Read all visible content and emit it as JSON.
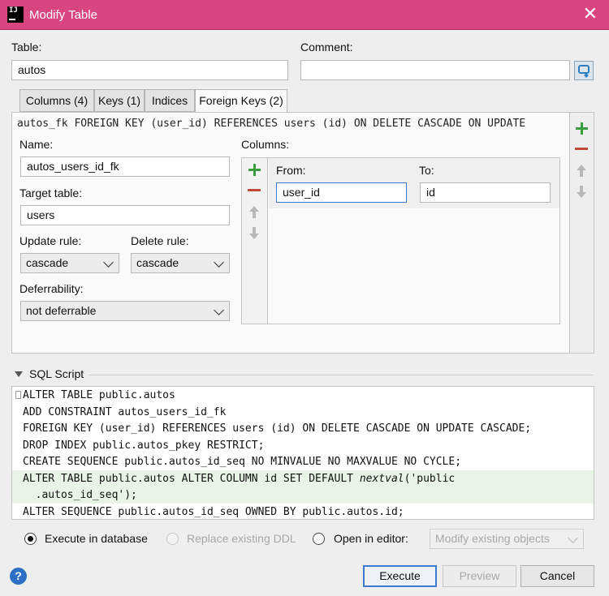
{
  "window": {
    "title": "Modify Table",
    "app_icon": "intellij-logo",
    "app_icon_text": "IJ"
  },
  "table": {
    "label": "Table:",
    "value": "autos"
  },
  "comment": {
    "label": "Comment:",
    "value": ""
  },
  "tabs": [
    {
      "label": "Columns (4)",
      "active": false
    },
    {
      "label": "Keys (1)",
      "active": false
    },
    {
      "label": "Indices",
      "active": false
    },
    {
      "label": "Foreign Keys (2)",
      "active": true
    }
  ],
  "foreign_key": {
    "definition": "autos_fk FOREIGN KEY (user_id) REFERENCES users (id) ON DELETE CASCADE ON UPDATE",
    "name_label": "Name:",
    "name_value": "autos_users_id_fk",
    "target_label": "Target table:",
    "target_value": "users",
    "update_label": "Update rule:",
    "update_value": "cascade",
    "delete_label": "Delete rule:",
    "delete_value": "cascade",
    "deferrability_label": "Deferrability:",
    "deferrability_value": "not deferrable",
    "columns_label": "Columns:",
    "from_label": "From:",
    "from_value": "user_id",
    "to_label": "To:",
    "to_value": "id"
  },
  "sql": {
    "header": "SQL Script",
    "lines": [
      "ALTER TABLE public.autos",
      "ADD CONSTRAINT autos_users_id_fk",
      "FOREIGN KEY (user_id) REFERENCES users (id) ON DELETE CASCADE ON UPDATE CASCADE;",
      "DROP INDEX public.autos_pkey RESTRICT;",
      "CREATE SEQUENCE public.autos_id_seq NO MINVALUE NO MAXVALUE NO CYCLE;",
      "ALTER TABLE public.autos ALTER COLUMN id SET DEFAULT ",
      "nextval",
      "('public",
      "  .autos_id_seq');",
      "ALTER SEQUENCE public.autos_id_seq OWNED BY public.autos.id;"
    ]
  },
  "options": {
    "execute_in_db": "Execute in database",
    "replace_ddl": "Replace existing DDL",
    "open_in_editor": "Open in editor:",
    "editor_mode": "Modify existing objects"
  },
  "buttons": {
    "execute": "Execute",
    "preview": "Preview",
    "cancel": "Cancel",
    "help": "?"
  },
  "colors": {
    "titlebar": "#d8457f",
    "accent": "#3b7ad0",
    "add": "#3a9e3a",
    "remove": "#c24a3a"
  }
}
